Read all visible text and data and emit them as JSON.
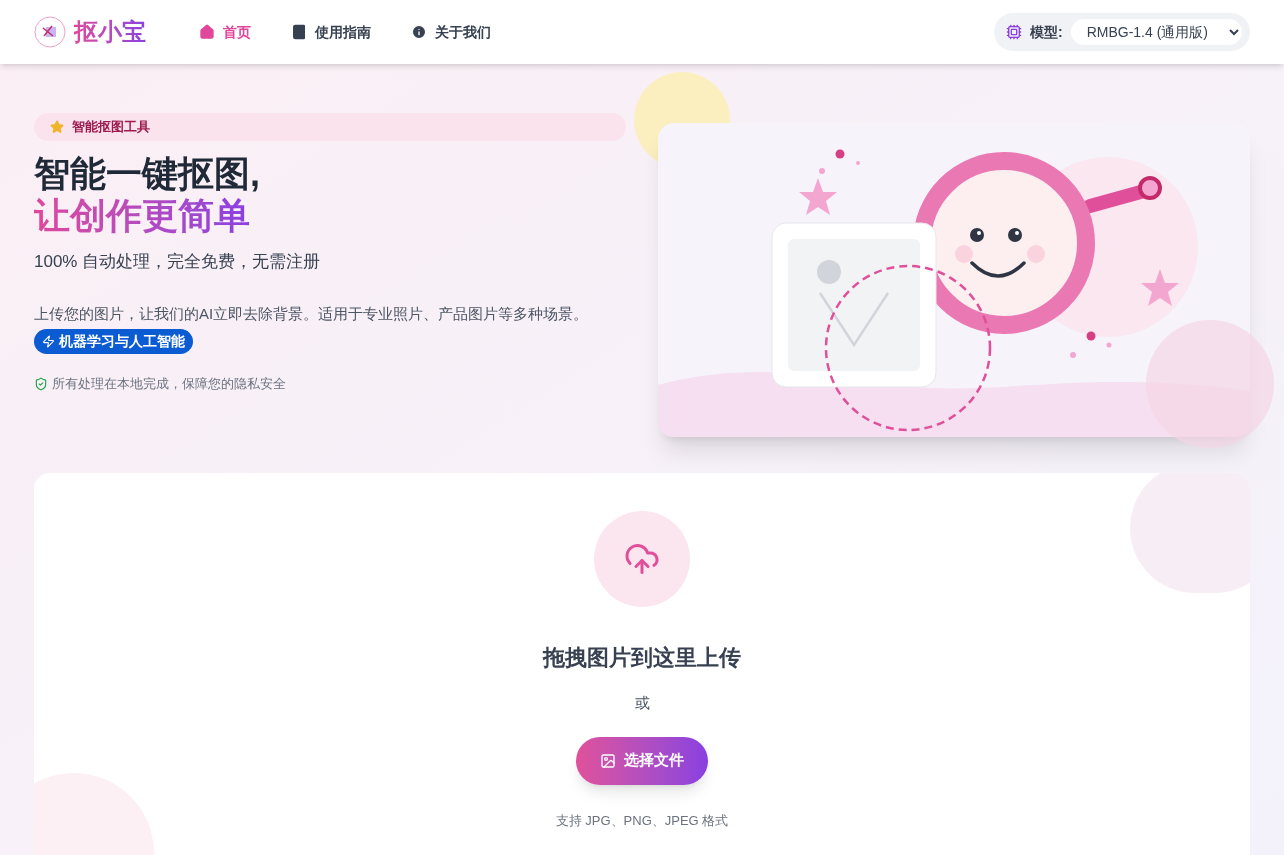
{
  "header": {
    "logo_text": "抠小宝",
    "nav": [
      {
        "label": "首页",
        "kind": "home",
        "selected": true
      },
      {
        "label": "使用指南",
        "kind": "guide",
        "selected": false
      },
      {
        "label": "关于我们",
        "kind": "about",
        "selected": false
      }
    ],
    "model": {
      "label": "模型:",
      "value": "RMBG-1.4 (通用版)"
    }
  },
  "hero": {
    "badge": "智能抠图工具",
    "title_line1": "智能一键抠图,",
    "title_line2": "让创作更简单",
    "subtitle": "100% 自动处理，完全免费，无需注册",
    "description": "上传您的图片，让我们的AI立即去除背景。适用于专业照片、产品图片等多种场景。",
    "tag": "机器学习与人工智能",
    "privacy": "所有处理在本地完成，保障您的隐私安全"
  },
  "upload": {
    "title": "拖拽图片到这里上传",
    "or": "或",
    "button": "选择文件",
    "formats": "支持 JPG、PNG、JPEG 格式"
  }
}
